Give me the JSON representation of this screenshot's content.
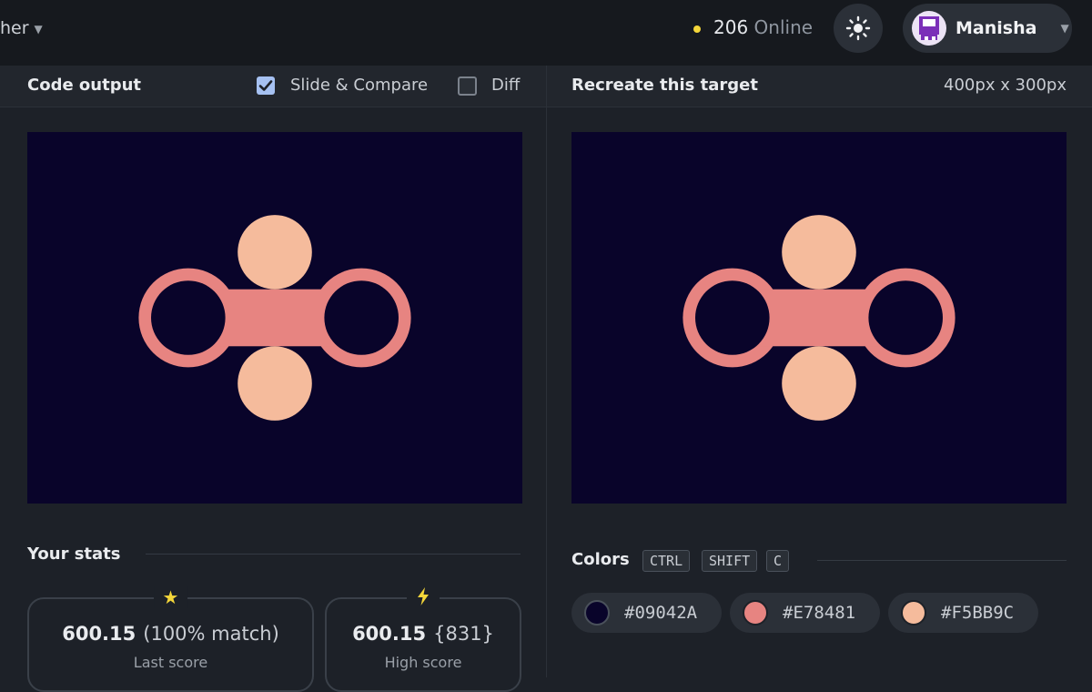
{
  "nav": {
    "fragment": "her"
  },
  "online": {
    "count": "206",
    "label": "Online",
    "dot_color": "#f4d63a"
  },
  "user": {
    "name": "Manisha",
    "theme_icon": "sun-icon"
  },
  "left_panel": {
    "title": "Code output",
    "slide_compare_label": "Slide & Compare",
    "slide_compare_checked": true,
    "diff_label": "Diff",
    "diff_checked": false
  },
  "right_panel": {
    "title": "Recreate this target",
    "dimensions": "400px x 300px"
  },
  "target_image": {
    "background": "#09042a",
    "ring_color": "#e78481",
    "circle_color": "#f5bb9c"
  },
  "stats": {
    "title": "Your stats",
    "last": {
      "icon": "star-icon",
      "value": "600.15",
      "detail": "(100% match)",
      "label": "Last score"
    },
    "high": {
      "icon": "lightning-icon",
      "value": "600.15",
      "detail": "{831}",
      "label": "High score"
    }
  },
  "colors": {
    "title": "Colors",
    "shortcut": [
      "CTRL",
      "SHIFT",
      "C"
    ],
    "swatches": [
      {
        "hex": "#09042A",
        "color": "#09042a"
      },
      {
        "hex": "#E78481",
        "color": "#e78481"
      },
      {
        "hex": "#F5BB9C",
        "color": "#f5bb9c"
      }
    ]
  }
}
